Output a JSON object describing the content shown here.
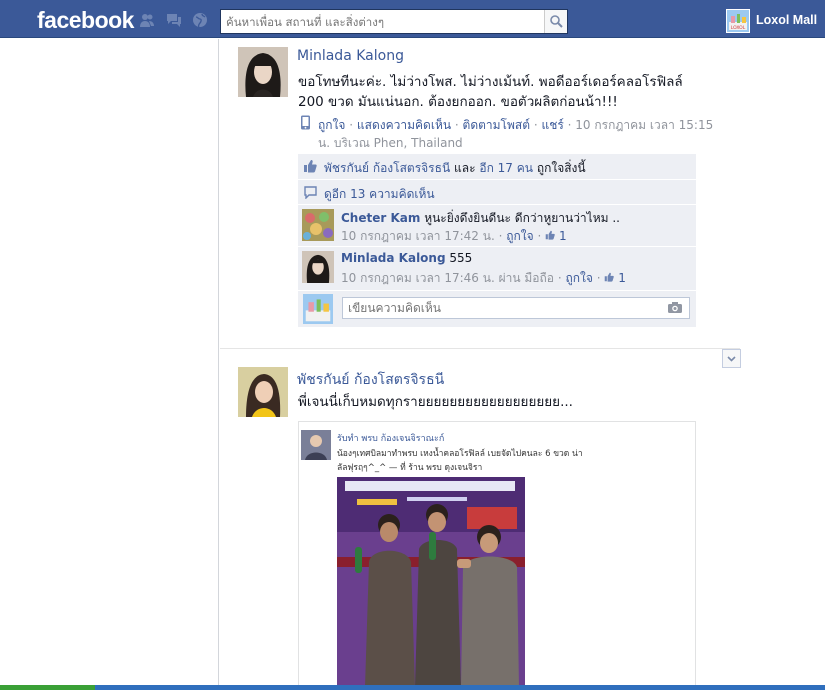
{
  "header": {
    "logo": "facebook",
    "search_placeholder": "ค้นหาเพื่อน สถานที่ และสิ่งต่างๆ",
    "user_name": "Loxol Mall",
    "user_avatar_text": "LOXOL"
  },
  "posts": [
    {
      "author": "Minlada Kalong",
      "text_lines": [
        "ขอโทษทีนะค่ะ. ไม่ว่างโพส. ไม่ว่างเม้นท์. พอดีออร์เดอร์คลอโรฟิลล์",
        "200 ขวด มันแน่นอก. ต้องยกออก. ขอตัวผลิตก่อนน้า!!!"
      ],
      "actions": {
        "like": "ถูกใจ",
        "comment": "แสดงความคิดเห็น",
        "follow": "ติดตามโพสต์",
        "share": "แชร์",
        "time": "10 กรกฎาคม เวลา 15:15",
        "time_cont": "น. บริเวณ Phen, Thailand"
      },
      "likes": {
        "name": "พัชรกันย์ ก้องโสตรจิรธนี",
        "and": "และ",
        "others": "อีก 17 คน",
        "suffix": "ถูกใจสิ่งนี้"
      },
      "view_more": "ดูอีก 13 ความคิดเห็น",
      "comments": [
        {
          "name": "Cheter Kam",
          "text": "หูนะยิ่งดึงยินดีนะ ดีกว่าหูยานว่าไหม ..",
          "time": "10 กรกฎาคม เวลา 17:42 น.",
          "via": "",
          "like": "ถูกใจ",
          "likes_count": "1"
        },
        {
          "name": "Minlada Kalong",
          "text": "555",
          "time": "10 กรกฎาคม เวลา 17:46 น.",
          "via": "ผ่าน มือถือ",
          "like": "ถูกใจ",
          "likes_count": "1"
        }
      ],
      "comment_placeholder": "เขียนความคิดเห็น"
    },
    {
      "author": "พัชรกันย์ ก้องโสตรจิรธนี",
      "text": "พี่เจนนี่เก็บหมดทุกรายยยยยยยยยยยยยยยยยย...",
      "shared": {
        "author": "รับทำ พรบ ก้องเจนจิราณะก์",
        "line1": "น้องๆเทศบิลมาทำพรบ เหงน้ำคลอโรฟิลล์ เบยจัดไปคนละ 6 ขวด น่า",
        "line2": "ลัลฟุรฤๆ^_^ — ที่ ร้าน พรบ ดุงเจนจิรา"
      }
    }
  ],
  "colors": {
    "brand": "#3b5998",
    "link": "#3b5998",
    "meta": "#90949c",
    "ufi_bg": "#edeff4"
  }
}
